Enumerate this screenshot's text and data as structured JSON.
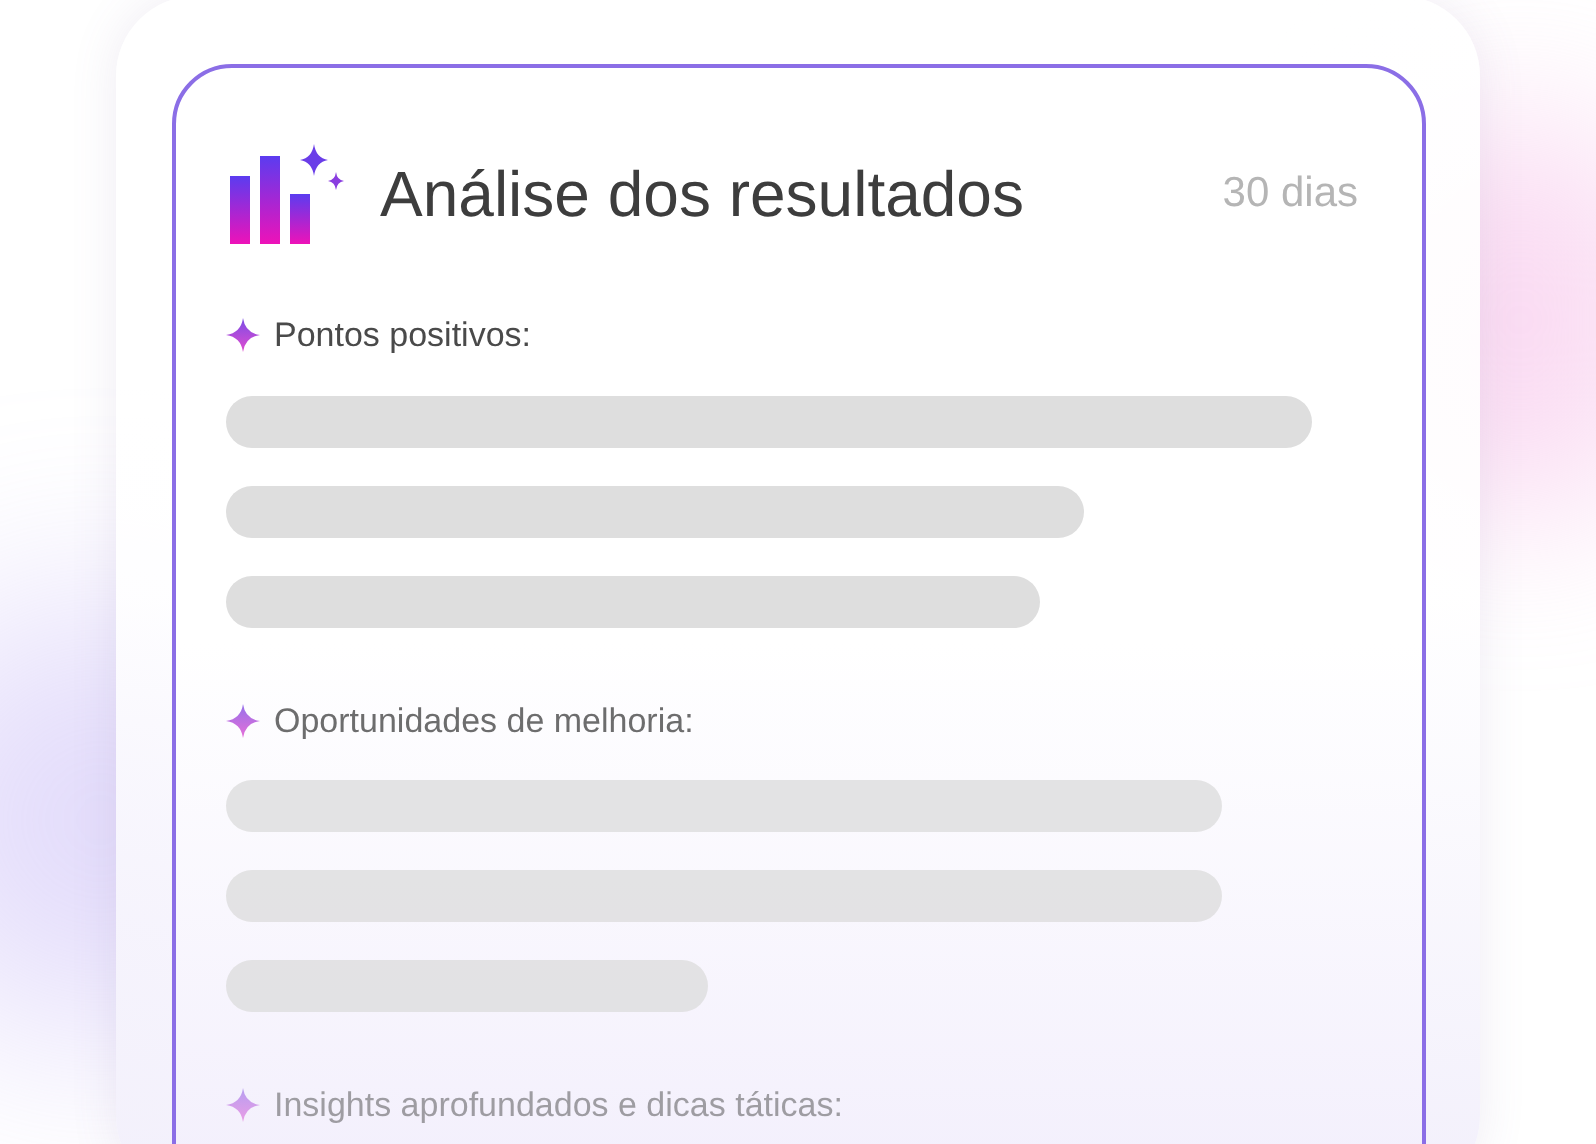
{
  "card": {
    "title": "Análise dos resultados",
    "period": "30 dias"
  },
  "sections": [
    {
      "heading": "Pontos positivos:"
    },
    {
      "heading": "Oportunidades de melhoria:"
    },
    {
      "heading": "Insights aprofundados e dicas táticas:"
    }
  ]
}
